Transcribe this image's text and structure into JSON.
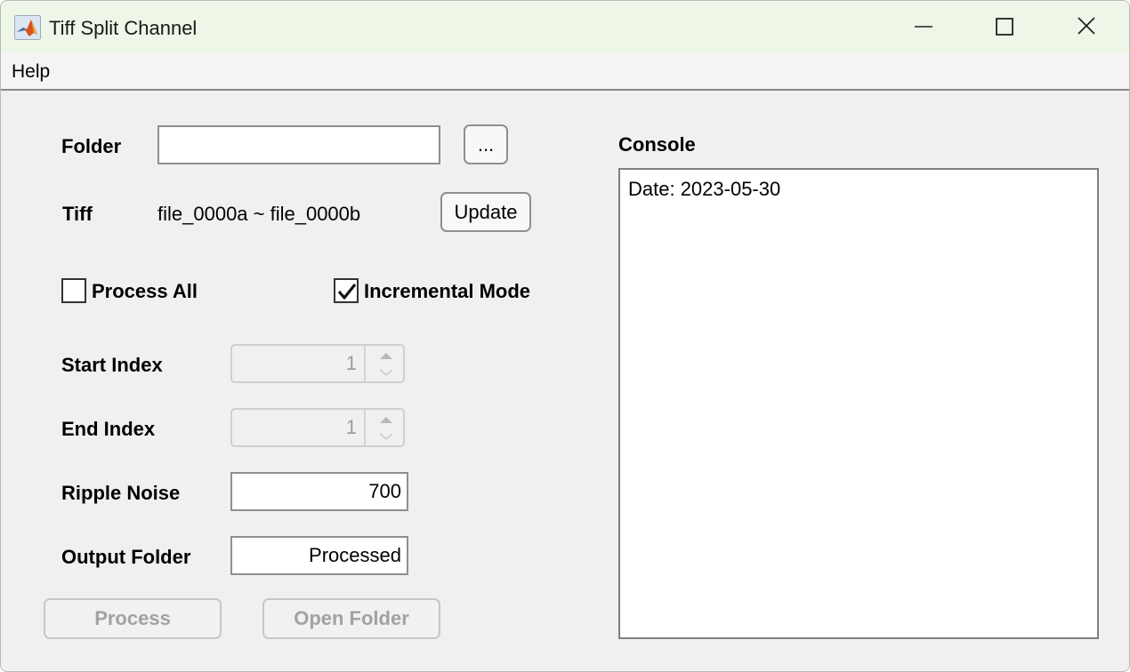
{
  "window": {
    "title": "Tiff Split Channel",
    "icon": "matlab-icon"
  },
  "menu": {
    "help": "Help"
  },
  "form": {
    "folder_label": "Folder",
    "folder_value": "",
    "browse_label": "...",
    "tiff_label": "Tiff",
    "tiff_value": "file_0000a ~ file_0000b",
    "update_label": "Update",
    "process_all_label": "Process All",
    "process_all_checked": false,
    "incremental_label": "Incremental Mode",
    "incremental_checked": true,
    "start_index_label": "Start Index",
    "start_index_value": "1",
    "end_index_label": "End Index",
    "end_index_value": "1",
    "ripple_label": "Ripple Noise",
    "ripple_value": "700",
    "output_label": "Output Folder",
    "output_value": "Processed",
    "process_label": "Process",
    "open_folder_label": "Open Folder"
  },
  "console": {
    "label": "Console",
    "lines": [
      "Date: 2023-05-30"
    ]
  },
  "colors": {
    "titlebar": "#eef6e7",
    "background": "#f0f0f0",
    "disabled_text": "#a2a2a2"
  }
}
